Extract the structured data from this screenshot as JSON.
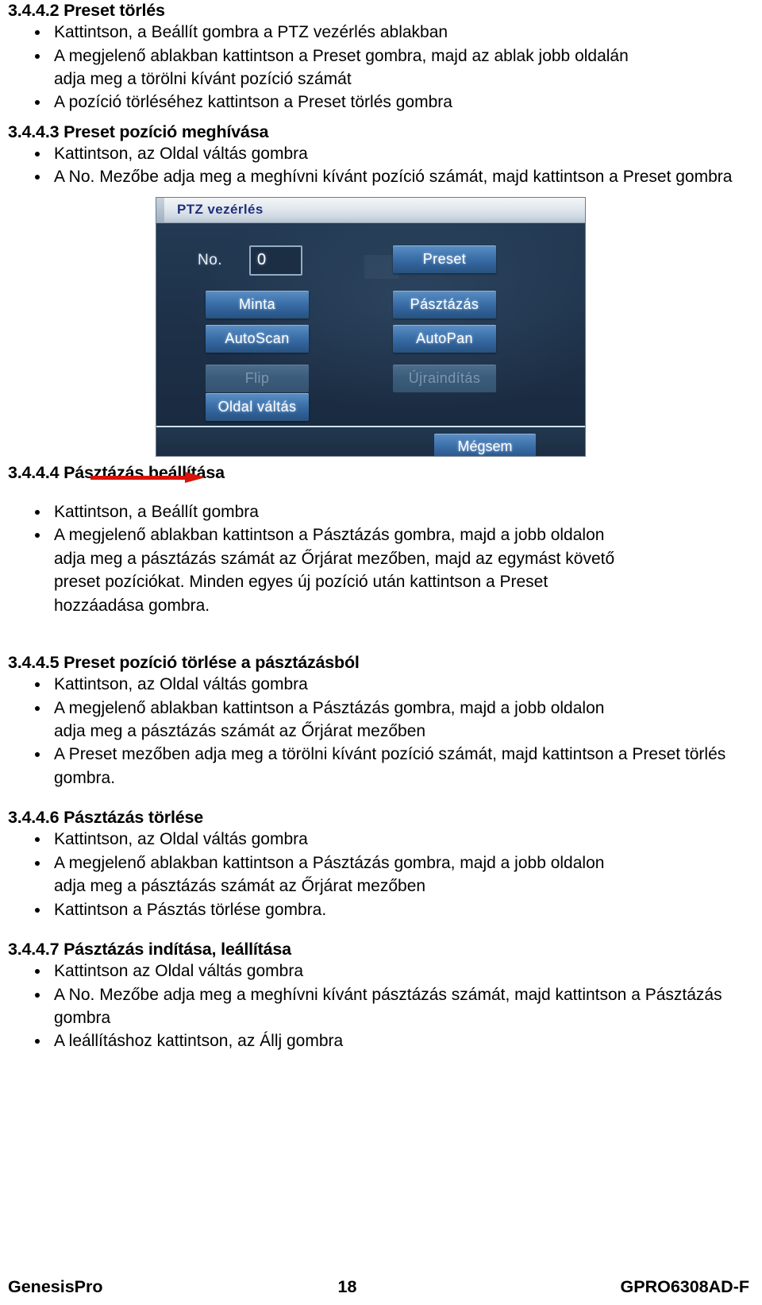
{
  "document": {
    "language": "hu",
    "page_number": "18"
  },
  "sections": [
    {
      "id": "3.4.4.2",
      "heading": "3.4.4.2 Preset törlés",
      "bullets": [
        {
          "lines": [
            "Kattintson, a Beállít gombra a PTZ vezérlés ablakban"
          ]
        },
        {
          "lines": [
            "A megjelenő ablakban kattintson a Preset gombra, majd az ablak jobb oldalán",
            "adja meg a törölni kívánt pozíció számát"
          ]
        },
        {
          "lines": [
            "A pozíció törléséhez kattintson a Preset törlés gombra"
          ]
        }
      ]
    },
    {
      "id": "3.4.4.3",
      "heading": "3.4.4.3 Preset pozíció meghívása",
      "bullets": [
        {
          "lines": [
            "Kattintson, az Oldal váltás gombra"
          ]
        },
        {
          "lines": [
            "A No. Mezőbe adja meg a meghívni kívánt pozíció számát, majd kattintson a",
            "Preset gombra"
          ]
        }
      ]
    },
    {
      "id": "3.4.4.4",
      "heading": "3.4.4.4 Pásztázás beállítása",
      "bullets": [
        {
          "lines": [
            "Kattintson, a Beállít gombra"
          ]
        },
        {
          "lines": [
            "A megjelenő ablakban kattintson a Pásztázás gombra, majd a jobb oldalon",
            "adja meg a pásztázás számát az Őrjárat mezőben, majd az egymást követő",
            "preset pozíciókat. Minden egyes új pozíció után kattintson a Preset",
            "hozzáadása gombra."
          ]
        }
      ]
    },
    {
      "id": "3.4.4.5",
      "heading": "3.4.4.5 Preset pozíció törlése a pásztázásból",
      "bullets": [
        {
          "lines": [
            "Kattintson, az Oldal váltás gombra"
          ]
        },
        {
          "lines": [
            "A megjelenő ablakban kattintson a Pásztázás gombra, majd a jobb oldalon",
            "adja meg a pásztázás számát az Őrjárat mezőben"
          ]
        },
        {
          "lines": [
            "A Preset mezőben adja meg a törölni kívánt pozíció számát, majd kattintson a",
            "Preset törlés gombra."
          ]
        }
      ]
    },
    {
      "id": "3.4.4.6",
      "heading": "3.4.4.6 Pásztázás törlése",
      "bullets": [
        {
          "lines": [
            "Kattintson, az Oldal váltás gombra"
          ]
        },
        {
          "lines": [
            "A megjelenő ablakban kattintson a Pásztázás gombra, majd a jobb oldalon",
            "adja meg a pásztázás számát az Őrjárat mezőben"
          ]
        },
        {
          "lines": [
            "Kattintson a Pásztás törlése gombra."
          ]
        }
      ]
    },
    {
      "id": "3.4.4.7",
      "heading": "3.4.4.7 Pásztázás indítása, leállítása",
      "bullets": [
        {
          "lines": [
            "Kattintson az Oldal váltás gombra"
          ]
        },
        {
          "lines": [
            "A No. Mezőbe adja meg a meghívni kívánt pásztázás számát, majd kattintson",
            "a Pásztázás gombra"
          ]
        },
        {
          "lines": [
            "A leállításhoz kattintson, az Állj gombra"
          ]
        }
      ]
    }
  ],
  "figure": {
    "annotation_icon": "red-right-arrow",
    "dialog": {
      "title": "PTZ vezérlés",
      "field_label": "No.",
      "field_value": "0",
      "buttons_left": [
        {
          "label": "Minta",
          "disabled": false
        },
        {
          "label": "AutoScan",
          "disabled": false
        },
        {
          "label": "Flip",
          "disabled": true
        },
        {
          "label": "Oldal váltás",
          "disabled": false
        }
      ],
      "buttons_right": [
        {
          "label": "Preset",
          "disabled": false
        },
        {
          "label": "Pásztázás",
          "disabled": false
        },
        {
          "label": "AutoPan",
          "disabled": false
        },
        {
          "label": "Újraindítás",
          "disabled": true
        }
      ],
      "cancel_label": "Mégsem",
      "colors": {
        "title_text": "#1d2f7a",
        "panel_bg": "#1e3249",
        "button_blue": "#3f74ad",
        "arrow_red": "#d8130b"
      }
    }
  },
  "footer": {
    "left": "GenesisPro",
    "center": "18",
    "right": "GPRO6308AD-F"
  }
}
